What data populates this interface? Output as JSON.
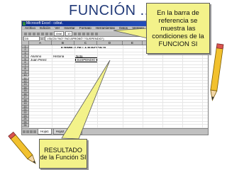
{
  "slide": {
    "title": "FUNCIÓN ..SI"
  },
  "excel": {
    "window_title": "Microsoft Excel - cdirat.",
    "menu": [
      "Archivo",
      "Edición",
      "Ver",
      "Insertar",
      "Formato",
      "Herramientas",
      "Datos",
      "Ventana",
      "?",
      "Tabulación"
    ],
    "toolbar": {
      "font": "Arial",
      "size": "10"
    },
    "formula_bar": {
      "name_box": "D5",
      "formula": "=SI(C5=\"NO\";\"NO APROBÓ\";\"SUSPENDIO\")"
    },
    "columns": [
      "A",
      "B",
      "C",
      "D",
      "E",
      "F",
      "G",
      "H",
      "I"
    ],
    "rows": [
      "1",
      "2",
      "3",
      "4",
      "5",
      "6",
      "7",
      "8",
      "9",
      "10",
      "11",
      "12",
      "13",
      "14",
      "15",
      "16",
      "17",
      "18",
      "19",
      "20",
      "21",
      "22",
      "23",
      "24",
      "25",
      "26"
    ],
    "cells": {
      "title": "EJEMPLO DE LA FUNCION SI",
      "header_alumno": "Alumno",
      "header_historia": "Historia",
      "header_nota": "Nota",
      "student_name": "Juan Perez",
      "result_value": "SUSPENDIO"
    },
    "sheet_tabs": [
      "Hoja1",
      "Hoja2",
      "Hoja3"
    ]
  },
  "callouts": {
    "formula_note": "En la barra de referencia se muestra las condiciones de la FUNCION SI",
    "result_note": "RESULTADO de la Función SI"
  },
  "colors": {
    "title": "#223a78",
    "callout_fill": "#f3f28a",
    "excel_titlebar": "#0a2a8c"
  }
}
